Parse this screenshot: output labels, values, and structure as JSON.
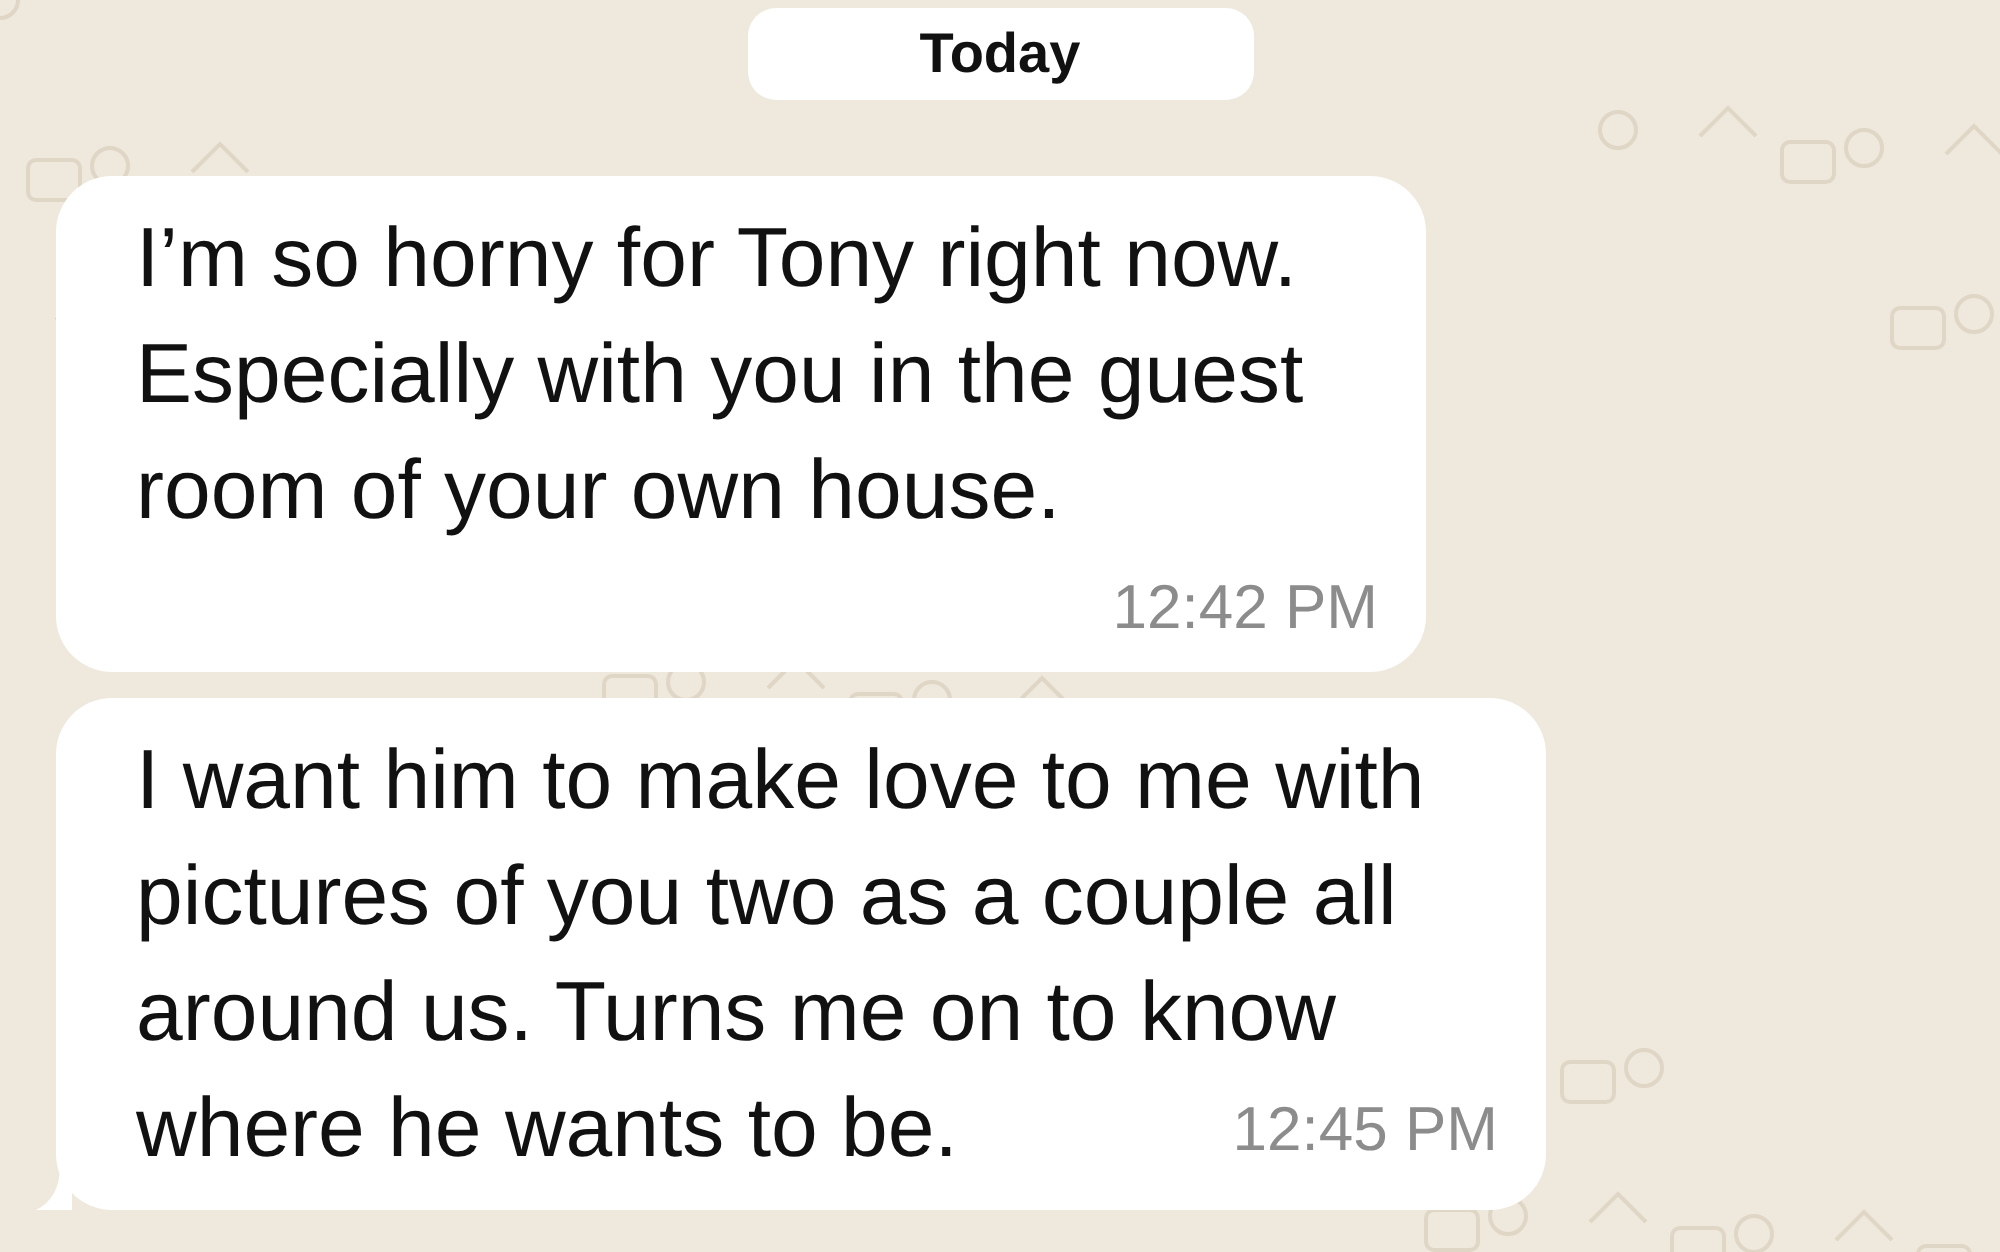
{
  "date_label": "Today",
  "messages": [
    {
      "text": "I’m so horny for Tony right now.\nEspecially with you in the guest\nroom of your own house.",
      "time": "12:42 PM",
      "tail": false
    },
    {
      "text": "I want him to make love to me with\npictures of you two as a couple all\naround us. Turns me on to know\nwhere he wants to be.",
      "time": "12:45 PM",
      "tail": true
    }
  ]
}
